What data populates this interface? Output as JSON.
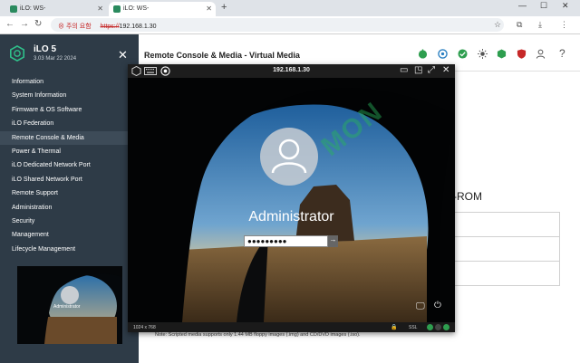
{
  "browser": {
    "tabs": [
      {
        "label": "iLO: WS-",
        "active": false
      },
      {
        "label": "iLO: WS-",
        "active": true
      }
    ],
    "new_tab": "+",
    "window_controls": [
      "—",
      "☐",
      "✕"
    ],
    "address": {
      "warning": "주의 요함",
      "scheme": "https://",
      "host": "192.168.1.30"
    }
  },
  "sidebar": {
    "product": "iLO 5",
    "version": "3.03 Mar 22 2024",
    "items": [
      {
        "label": "Information",
        "selected": false
      },
      {
        "label": "System Information",
        "selected": false
      },
      {
        "label": "Firmware & OS Software",
        "selected": false
      },
      {
        "label": "iLO Federation",
        "selected": false
      },
      {
        "label": "Remote Console & Media",
        "selected": true
      },
      {
        "label": "Power & Thermal",
        "selected": false
      },
      {
        "label": "iLO Dedicated Network Port",
        "selected": false
      },
      {
        "label": "iLO Shared Network Port",
        "selected": false
      },
      {
        "label": "Remote Support",
        "selected": false
      },
      {
        "label": "Administration",
        "selected": false
      },
      {
        "label": "Security",
        "selected": false
      },
      {
        "label": "Management",
        "selected": false
      },
      {
        "label": "Lifecycle Management",
        "selected": false
      }
    ],
    "thumbnail_user": "Administrator"
  },
  "main": {
    "title": "Remote Console & Media - Virtual Media",
    "cdrom_heading": "-ROM",
    "note": "Note: Scripted media supports only 1.44 MB floppy images (.img) and CD/DVD images (.iso).",
    "status_icons": [
      {
        "name": "power-icon",
        "color": "#2e9e4f"
      },
      {
        "name": "health-icon",
        "color": "#2a7fc1"
      },
      {
        "name": "check-icon",
        "color": "#2e9e4f"
      },
      {
        "name": "uid-icon",
        "color": "#555555"
      },
      {
        "name": "shield-green-icon",
        "color": "#2e9e4f"
      },
      {
        "name": "shield-red-icon",
        "color": "#c62828"
      },
      {
        "name": "user-icon",
        "color": "#555555"
      },
      {
        "name": "help-icon",
        "color": "#555555"
      }
    ]
  },
  "console": {
    "title": "192.168.1.30",
    "resolution": "1024 x 768",
    "ssl": "SSL",
    "login": {
      "username": "Administrator",
      "password_mask": "●●●●●●●●●"
    },
    "watermark": "MON"
  }
}
